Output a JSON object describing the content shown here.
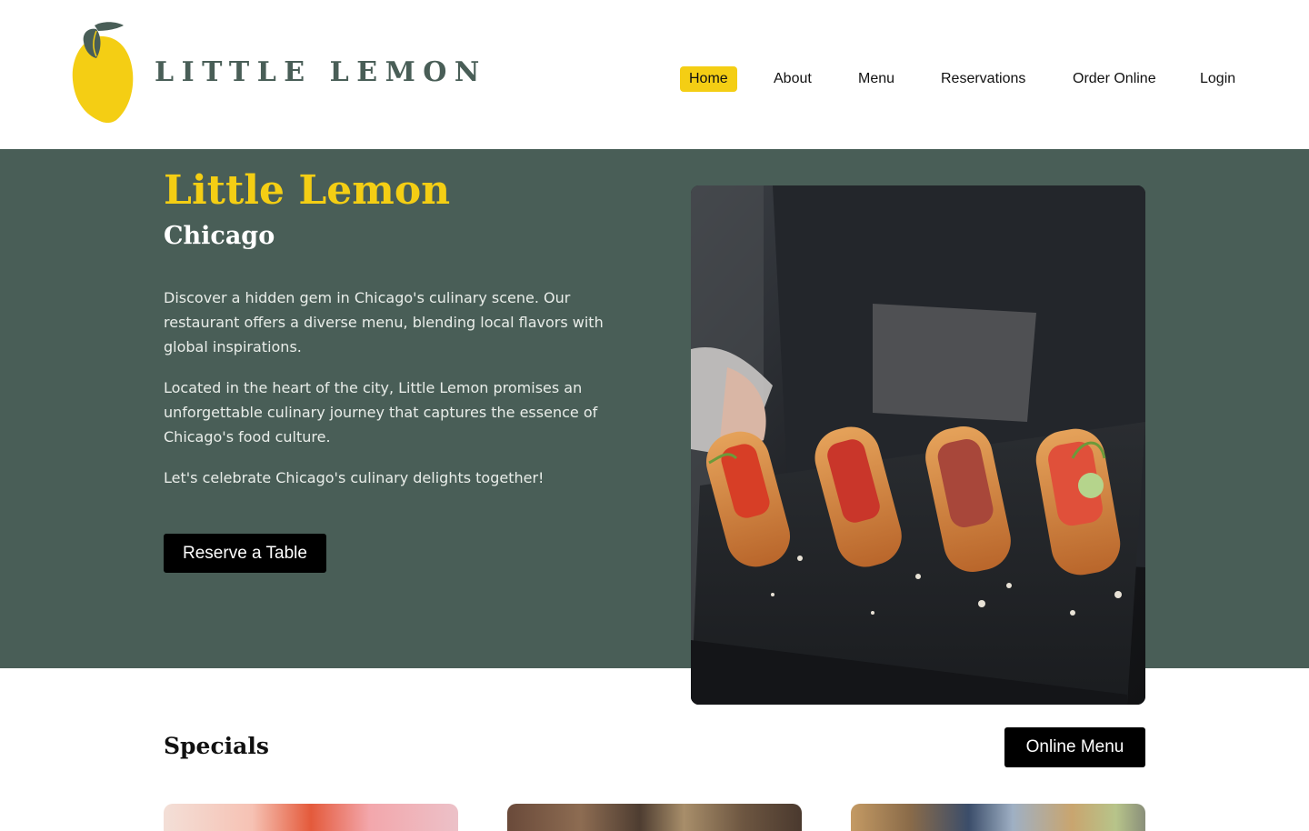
{
  "brand": {
    "name": "LITTLE LEMON",
    "colors": {
      "primary": "#495e57",
      "accent": "#f4ce14",
      "black": "#000000"
    }
  },
  "nav": {
    "items": [
      {
        "label": "Home",
        "active": true
      },
      {
        "label": "About",
        "active": false
      },
      {
        "label": "Menu",
        "active": false
      },
      {
        "label": "Reservations",
        "active": false
      },
      {
        "label": "Order Online",
        "active": false
      },
      {
        "label": "Login",
        "active": false
      }
    ]
  },
  "hero": {
    "title": "Little Lemon",
    "subtitle": "Chicago",
    "paragraphs": [
      "Discover a hidden gem in Chicago's culinary scene. Our restaurant offers a diverse menu, blending local flavors with global inspirations.",
      "Located in the heart of the city, Little Lemon promises an unforgettable culinary journey that captures the essence of Chicago's food culture.",
      "Let's celebrate Chicago's culinary delights together!"
    ],
    "cta_label": "Reserve a Table",
    "image_icon": "bruschetta-photo"
  },
  "specials": {
    "title": "Specials",
    "online_menu_label": "Online Menu",
    "cards": [
      {
        "image_icon": "greek-salad-photo"
      },
      {
        "image_icon": "bruschetta-dish-photo"
      },
      {
        "image_icon": "lemon-dessert-photo"
      }
    ]
  }
}
